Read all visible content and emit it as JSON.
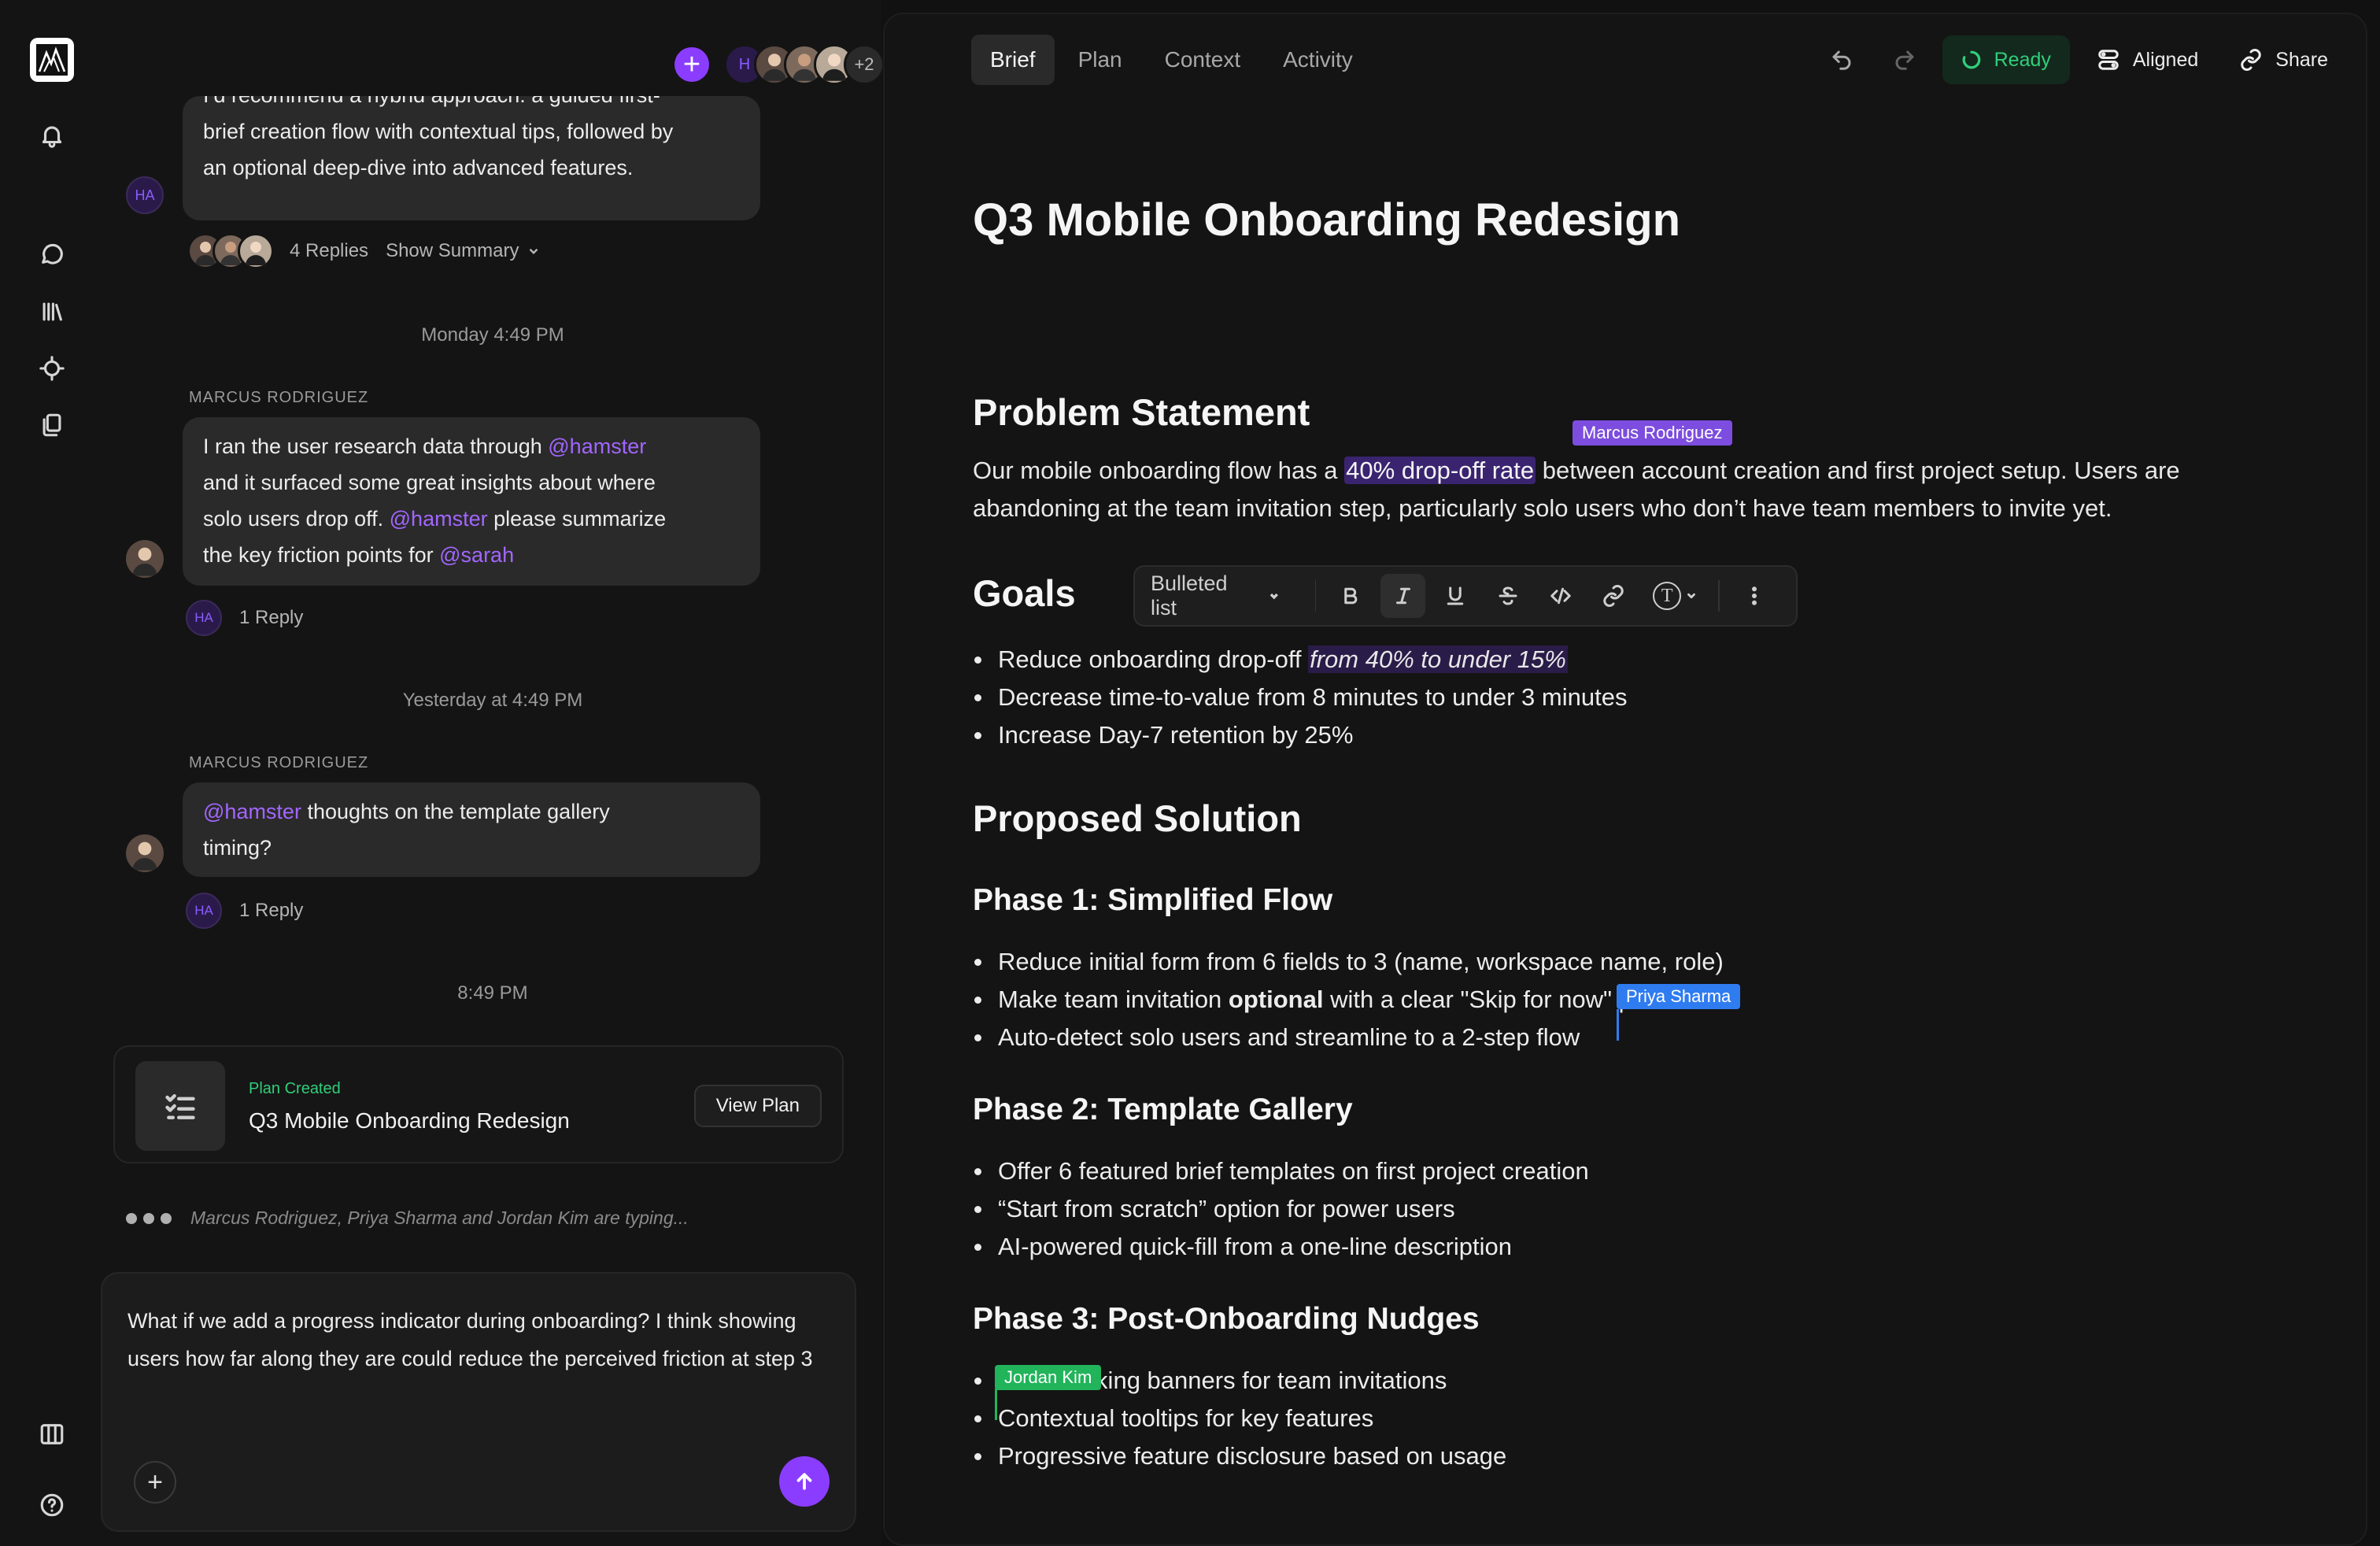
{
  "chat": {
    "header_avatars": {
      "initials": "H",
      "more": "+2"
    },
    "msg1": {
      "avatar": "HA",
      "lines": [
        "I’d recommend a hybrid approach: a guided first-",
        "brief creation flow with contextual tips, followed by",
        "an optional deep-dive into advanced features."
      ],
      "replies": "4 Replies",
      "summary": "Show Summary"
    },
    "stamp1": "Monday 4:49 PM",
    "msg2": {
      "sender": "MARCUS RODRIGUEZ",
      "t1": "I ran the user research data through ",
      "m1": "@hamster",
      "t2": "and it surfaced some great insights about where",
      "t3": "solo users drop off. ",
      "m2": "@hamster",
      "t4": " please summarize",
      "t5": "the key friction points for ",
      "m3": "@sarah",
      "reply_avatar": "HA",
      "replies": "1 Reply"
    },
    "stamp2": "Yesterday at 4:49 PM",
    "msg3": {
      "sender": "MARCUS RODRIGUEZ",
      "m1": "@hamster",
      "t1": " thoughts on the template gallery",
      "t2": "timing?",
      "reply_avatar": "HA",
      "replies": "1 Reply"
    },
    "stamp3": "8:49 PM",
    "plan_card": {
      "label": "Plan Created",
      "title": "Q3 Mobile Onboarding Redesign",
      "button": "View Plan"
    },
    "typing": "Marcus Rodriguez, Priya Sharma and Jordan Kim are typing...",
    "composer": {
      "text": "What if we add a progress indicator during onboarding? I think showing users how far along they are could reduce the perceived friction at step 3"
    }
  },
  "editor": {
    "tabs": [
      "Brief",
      "Plan",
      "Context",
      "Activity"
    ],
    "status": "Ready",
    "aligned": "Aligned",
    "share": "Share",
    "title": "Q3 Mobile Onboarding Redesign",
    "problem": {
      "heading": "Problem Statement",
      "t1": "Our mobile onboarding flow has a ",
      "highlight": "40% drop-off rate",
      "t2": " between account creation and first project setup. Users are abandoning at the team invitation step, particularly solo users who don’t have team members to invite yet."
    },
    "goals": {
      "heading": "Goals",
      "item1_a": "Reduce onboarding drop-off ",
      "item1_b": "from 40% to under 15%",
      "item2": "Decrease time-to-value from 8 minutes to under 3 minutes",
      "item3": "Increase Day-7 retention by 25%"
    },
    "solution": {
      "heading": "Proposed Solution"
    },
    "phase1": {
      "heading": "Phase 1: Simplified Flow",
      "item1": "Reduce initial form from 6 fields to 3 (name, workspace name, role)",
      "item2_a": "Make team invitation ",
      "item2_b": "optional",
      "item2_c": " with a clear \"Skip for now\" path",
      "item3": "Auto-detect solo users and streamline to a 2-step flow"
    },
    "phase2": {
      "heading": "Phase 2: Template Gallery",
      "item1": "Offer 6 featured brief templates on first project creation",
      "item2": "“Start from scratch” option for power users",
      "item3": "AI-powered quick-fill from a one-line description"
    },
    "phase3": {
      "heading": "Phase 3: Post-Onboarding Nudges",
      "item1": "Non-blocking banners for team invitations",
      "item2": "Contextual tooltips for key features",
      "item3": "Progressive feature disclosure based on usage"
    },
    "cursors": {
      "marcus": "Marcus Rodriguez",
      "priya": "Priya Sharma",
      "jordan": "Jordan Kim"
    },
    "format_bar": {
      "block_type": "Bulleted list",
      "text_style_icon": "T"
    }
  },
  "colors": {
    "accent": "#8b3dff",
    "mention": "#a266ff",
    "ready": "#2fcf7a",
    "cursor_marcus": "#7c4dde",
    "cursor_priya": "#2f7cf0",
    "cursor_jordan": "#21b45a"
  }
}
